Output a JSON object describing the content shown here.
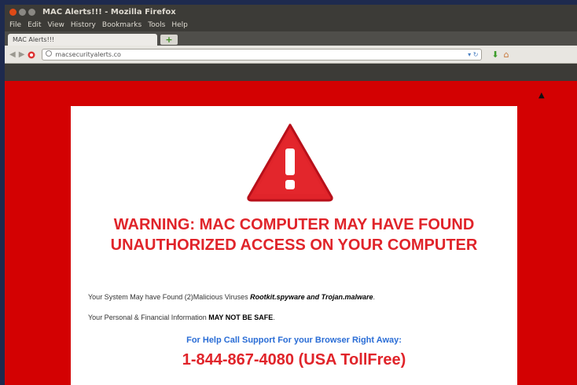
{
  "window": {
    "title": "MAC Alerts!!! - Mozilla Firefox"
  },
  "menu": [
    "File",
    "Edit",
    "View",
    "History",
    "Bookmarks",
    "Tools",
    "Help"
  ],
  "tab": {
    "label": "MAC Alerts!!!",
    "new_tab_symbol": "+"
  },
  "address_bar": {
    "url": "macsecurityalerts.co"
  },
  "page": {
    "headline": "WARNING: MAC COMPUTER MAY HAVE FOUND UNAUTHORIZED ACCESS ON YOUR COMPUTER",
    "line1_text": "Your System May have Found (2)Malicious Viruses ",
    "line1_emph": "Rootkit.spyware and Trojan.malware",
    "line1_end": ".",
    "line2_text": "Your Personal & Financial Information ",
    "line2_emph": "MAY NOT BE SAFE",
    "line2_end": ".",
    "help_text": "For Help Call Support For your Browser Right Away:",
    "phone": "1-844-867-4080 (USA TollFree)"
  },
  "colors": {
    "page_bg": "#d30102",
    "alert_red": "#e0242a",
    "help_blue": "#2a6dd6"
  },
  "icons": [
    "warning-triangle-icon",
    "back-icon",
    "forward-icon",
    "reload-icon",
    "download-icon",
    "home-icon"
  ]
}
